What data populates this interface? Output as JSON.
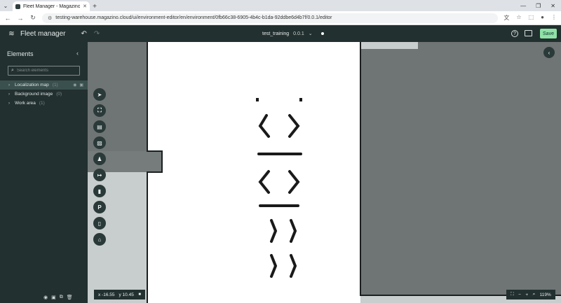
{
  "browser": {
    "tab_title": "Fleet Manager - Magazino",
    "url": "testing-warehouse.magazino.cloud/ui/environment-editor/en/environment/0fb66c38-6905-4b4c-b1da-92ddbe6d4b7f/0.0.1/editor"
  },
  "app": {
    "title": "Fleet manager",
    "environment_name": "test_training",
    "version": "0.0.1",
    "save_label": "Save"
  },
  "sidebar": {
    "heading": "Elements",
    "search_placeholder": "Search elements",
    "items": [
      {
        "label": "Localization map",
        "count": "(1)",
        "selected": true
      },
      {
        "label": "Background image",
        "count": "(0)",
        "selected": false
      },
      {
        "label": "Work area",
        "count": "(1)",
        "selected": false
      }
    ]
  },
  "tools": [
    {
      "name": "select",
      "icon": "cursor-arrow-icon"
    },
    {
      "name": "fit",
      "icon": "focus-frame-icon"
    },
    {
      "name": "shelf",
      "icon": "shelf-icon"
    },
    {
      "name": "hatched-area",
      "icon": "hatched-area-icon"
    },
    {
      "name": "station",
      "icon": "station-icon"
    },
    {
      "name": "path",
      "icon": "path-arrow-icon"
    },
    {
      "name": "charger",
      "icon": "charger-icon"
    },
    {
      "name": "parking",
      "icon": "parking-icon",
      "glyph": "P"
    },
    {
      "name": "device",
      "icon": "device-icon"
    },
    {
      "name": "dock",
      "icon": "dock-icon"
    }
  ],
  "status": {
    "x_label": "x -16.55",
    "y_label": "y 10.45",
    "zoom": "119%"
  },
  "colors": {
    "header_bg": "#22302f",
    "save_bg": "#8fe3a6",
    "selected_row": "#3a504e",
    "map_free": "#ffffff",
    "map_unknown": "#c8cdcd",
    "map_dark": "#6f7474"
  }
}
